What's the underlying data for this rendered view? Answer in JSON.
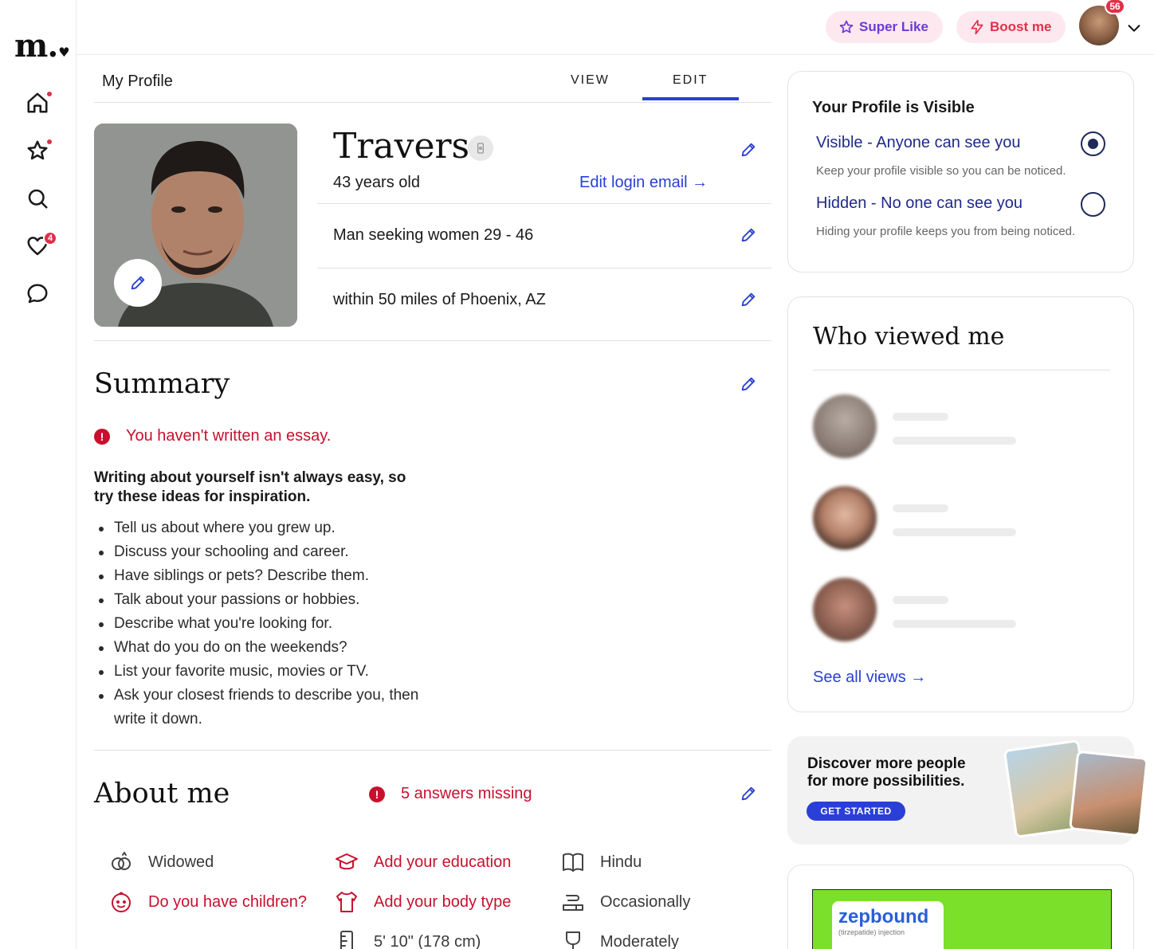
{
  "nav": {
    "logo": "m.",
    "likes_badge": "4"
  },
  "topbar": {
    "super_like": "Super Like",
    "boost": "Boost me",
    "avatar_badge": "56"
  },
  "tabs": {
    "title": "My Profile",
    "view": "VIEW",
    "edit": "EDIT"
  },
  "profile": {
    "name": "Travers",
    "age": "43 years old",
    "edit_email": "Edit login email →",
    "seeking": "Man seeking women 29 - 46",
    "location": "within 50 miles of Phoenix, AZ"
  },
  "summary": {
    "title": "Summary",
    "warning": "You haven't written an essay.",
    "tips_heading": "Writing about yourself isn't always easy, so try these ideas for inspiration.",
    "tips": [
      "Tell us about where you grew up.",
      "Discuss your schooling and career.",
      "Have siblings or pets? Describe them.",
      "Talk about your passions or hobbies.",
      "Describe what you're looking for.",
      "What do you do on the weekends?",
      "List your favorite music, movies or TV.",
      "Ask your closest friends to describe you, then write it down."
    ]
  },
  "about": {
    "title": "About me",
    "missing": "5 answers missing",
    "col1": [
      "Widowed",
      "Do you have children?"
    ],
    "col2": [
      "Add your education",
      "Add your body type",
      "5' 10\" (178 cm)"
    ],
    "col3": [
      "Hindu",
      "Occasionally",
      "Moderately"
    ]
  },
  "visibility": {
    "title": "Your Profile is Visible",
    "visible_label": "Visible - Anyone can see you",
    "visible_desc": "Keep your profile visible so you can be noticed.",
    "hidden_label": "Hidden - No one can see you",
    "hidden_desc": "Hiding your profile keeps you from being noticed.",
    "selected": "visible"
  },
  "views": {
    "title": "Who viewed me",
    "see_all": "See all views →"
  },
  "promo": {
    "text": "Discover more people for more possibilities.",
    "button": "GET STARTED"
  },
  "ad": {
    "brand": "zepbound",
    "sub": "(tirzepatide) injection"
  },
  "colors": {
    "accent": "#2a3fd6",
    "alert": "#c8102e",
    "badge": "#e0304a",
    "pill_bg": "#fde8ef"
  }
}
